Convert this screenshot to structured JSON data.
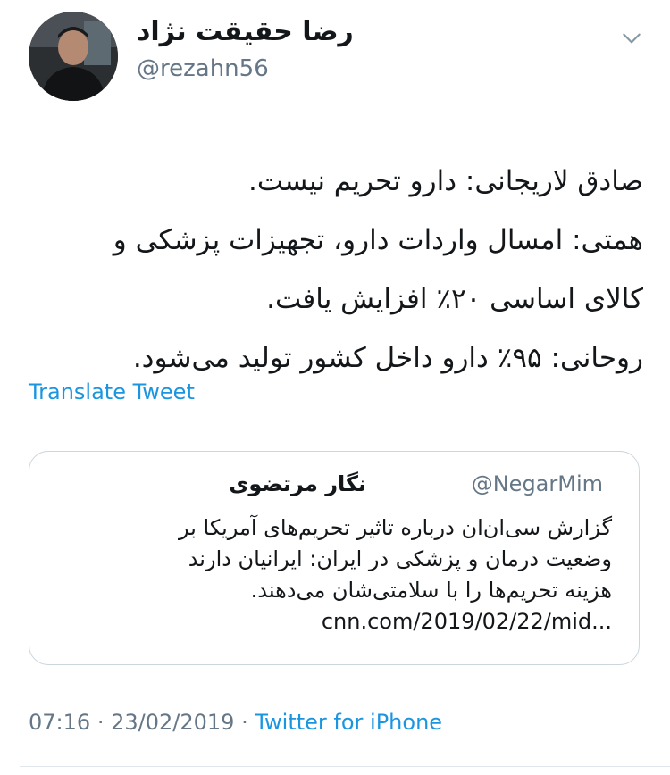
{
  "author": {
    "display_name": "رضا حقیقت نژاد",
    "handle": "@rezahn56",
    "avatar_icon": "user-avatar"
  },
  "tweet": {
    "lines": [
      "صادق لاریجانی: دارو تحریم نیست.",
      "همتی: امسال واردات دارو، تجهیزات پزشکی و",
      "کالای اساسی ۲۰٪ افزایش یافت.",
      "روحانی: ۹۵٪ دارو داخل کشور تولید می‌شود."
    ],
    "translate_label": "Translate Tweet"
  },
  "quoted_tweet": {
    "author_name": "نگار مرتضوی",
    "handle": "@NegarMim",
    "lines": [
      "گزارش سی‌ان‌ان درباره تاثیر تحریم‌های آمریکا بر",
      "وضعیت درمان و پزشکی در ایران: ایرانیان دارند",
      "هزینه تحریم‌ها را با سلامتی‌شان می‌دهند.",
      "cnn.com/2019/02/22/mid..."
    ]
  },
  "meta": {
    "time": "07:16",
    "separator": "·",
    "date": "23/02/2019",
    "source": "Twitter for iPhone"
  },
  "colors": {
    "link": "#1b95e0",
    "secondary_text": "#657786",
    "border": "#ccd6dd"
  },
  "icons": {
    "more": "chevron-down-icon"
  }
}
